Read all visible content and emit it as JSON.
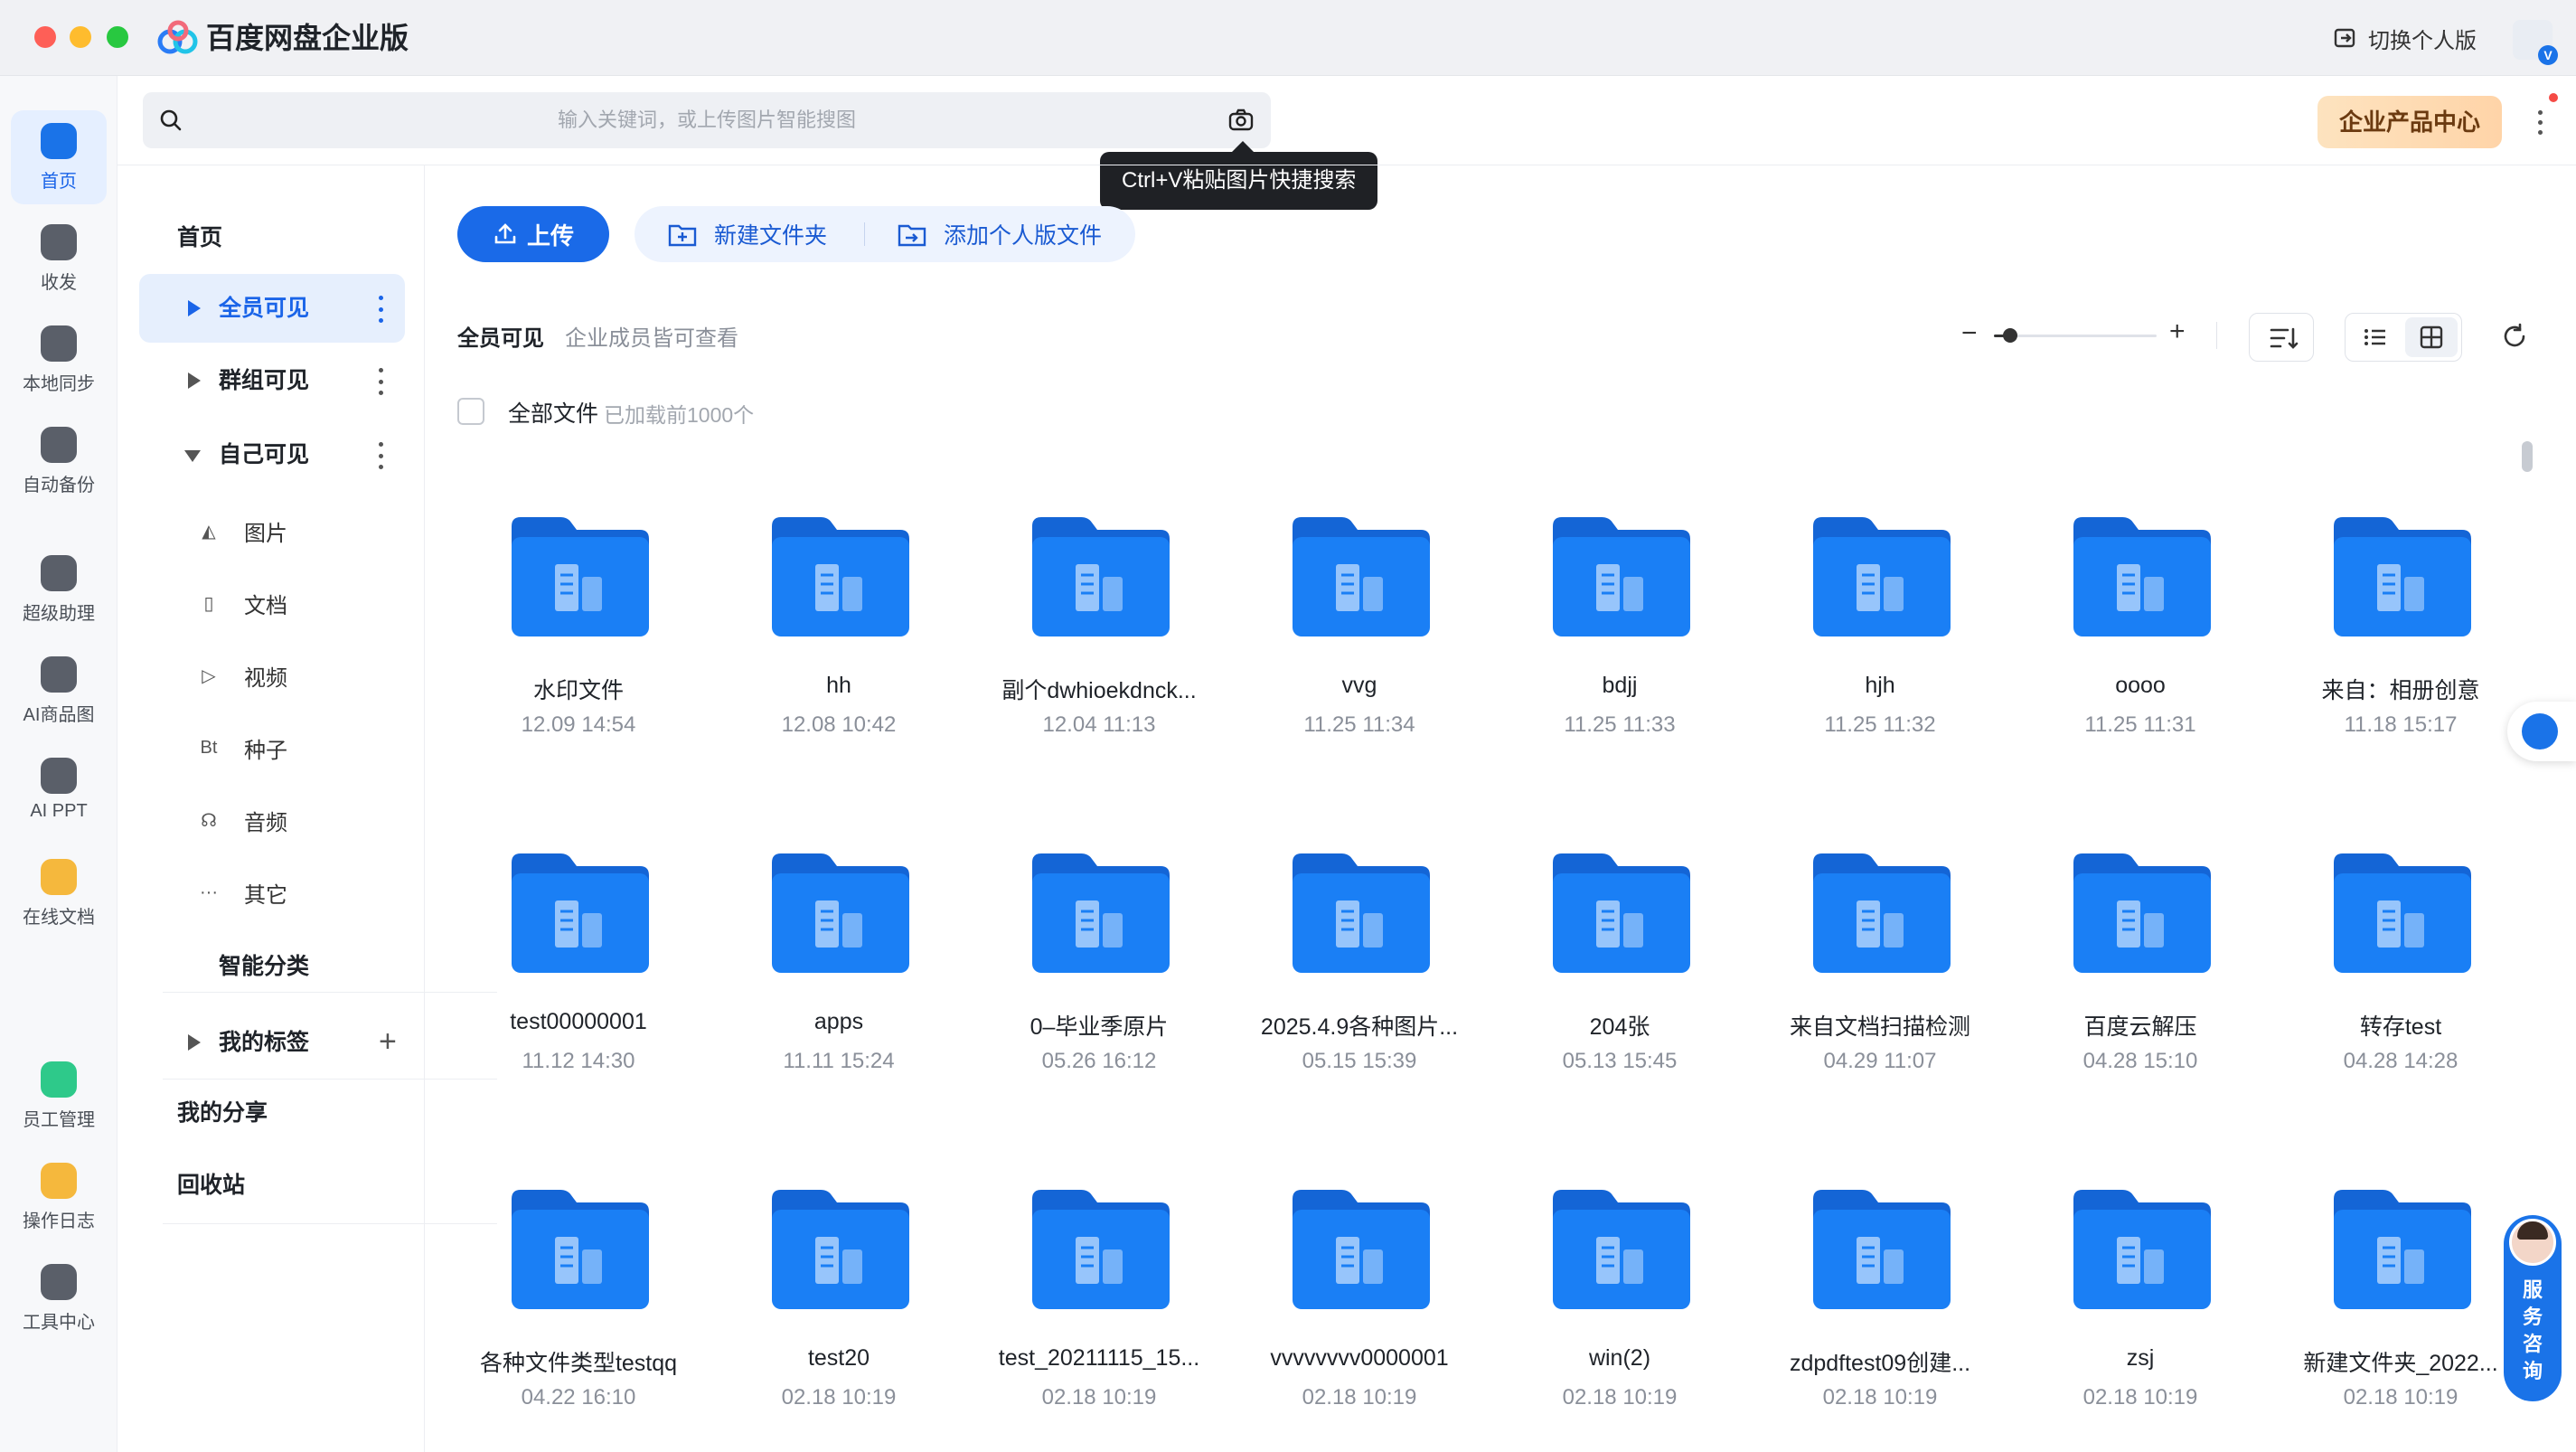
{
  "app": {
    "title": "百度网盘企业版",
    "switch_label": "切换个人版",
    "avatar_badge": "V"
  },
  "rail": [
    {
      "label": "首页",
      "icon": "home-icon",
      "color": "#1a73e8",
      "active": true
    },
    {
      "label": "收发",
      "icon": "transfer-icon",
      "color": "#5a5f69"
    },
    {
      "label": "本地同步",
      "icon": "sync-icon",
      "color": "#5a5f69"
    },
    {
      "label": "自动备份",
      "icon": "backup-icon",
      "color": "#5a5f69"
    },
    {
      "label": "超级助理",
      "icon": "ai-assistant-icon",
      "color": "#5a5f69"
    },
    {
      "label": "AI商品图",
      "icon": "ai-product-icon",
      "color": "#5a5f69"
    },
    {
      "label": "AI PPT",
      "icon": "ai-ppt-icon",
      "color": "#5a5f69"
    },
    {
      "label": "在线文档",
      "icon": "online-doc-icon",
      "color": "#f5b83d"
    },
    {
      "label": "员工管理",
      "icon": "staff-icon",
      "color": "#2ec98a"
    },
    {
      "label": "操作日志",
      "icon": "log-icon",
      "color": "#f5b83d"
    },
    {
      "label": "工具中心",
      "icon": "tools-icon",
      "color": "#5a5f69"
    }
  ],
  "search": {
    "placeholder": "输入关键词，或上传图片智能搜图",
    "tooltip": "Ctrl+V粘贴图片快捷搜索"
  },
  "product_center": "企业产品中心",
  "nav": {
    "home": "首页",
    "all_visible": "全员可见",
    "group_visible": "群组可见",
    "self_visible": "自己可见",
    "sub": [
      {
        "label": "图片",
        "icon": "image-icon",
        "glyph": "◭"
      },
      {
        "label": "文档",
        "icon": "document-icon",
        "glyph": "▯"
      },
      {
        "label": "视频",
        "icon": "video-icon",
        "glyph": "▷"
      },
      {
        "label": "种子",
        "icon": "torrent-icon",
        "glyph": "Bt"
      },
      {
        "label": "音频",
        "icon": "audio-icon",
        "glyph": "☊"
      },
      {
        "label": "其它",
        "icon": "other-icon",
        "glyph": "···"
      }
    ],
    "smart_category": "智能分类",
    "my_tags": "我的标签",
    "my_share": "我的分享",
    "recycle": "回收站"
  },
  "toolbar": {
    "upload": "上传",
    "new_folder": "新建文件夹",
    "add_personal": "添加个人版文件"
  },
  "scope": {
    "title": "全员可见",
    "desc": "企业成员皆可查看",
    "zoom_minus": "−",
    "zoom_plus": "+",
    "zoom_level": 0.1
  },
  "list": {
    "all_files": "全部文件",
    "loaded": "已加载前1000个"
  },
  "folders": [
    {
      "name": "水印文件",
      "date": "12.09 14:54"
    },
    {
      "name": "hh",
      "date": "12.08 10:42"
    },
    {
      "name": "副个dwhioekdnck...",
      "date": "12.04 11:13"
    },
    {
      "name": "vvg",
      "date": "11.25 11:34"
    },
    {
      "name": "bdjj",
      "date": "11.25 11:33"
    },
    {
      "name": "hjh",
      "date": "11.25 11:32"
    },
    {
      "name": "oooo",
      "date": "11.25 11:31"
    },
    {
      "name": "来自：相册创意",
      "date": "11.18 15:17"
    },
    {
      "name": "test00000001",
      "date": "11.12 14:30"
    },
    {
      "name": "apps",
      "date": "11.11 15:24"
    },
    {
      "name": "0–毕业季原片",
      "date": "05.26 16:12"
    },
    {
      "name": "2025.4.9各种图片...",
      "date": "05.15 15:39"
    },
    {
      "name": "204张",
      "date": "05.13 15:45"
    },
    {
      "name": "来自文档扫描检测",
      "date": "04.29 11:07"
    },
    {
      "name": "百度云解压",
      "date": "04.28 15:10"
    },
    {
      "name": "转存test",
      "date": "04.28 14:28"
    },
    {
      "name": "各种文件类型testqq",
      "date": "04.22 16:10"
    },
    {
      "name": "test20",
      "date": "02.18 10:19"
    },
    {
      "name": "test_20211115_15...",
      "date": "02.18 10:19"
    },
    {
      "name": "vvvvvvvv0000001",
      "date": "02.18 10:19"
    },
    {
      "name": "win(2)",
      "date": "02.18 10:19"
    },
    {
      "name": "zdpdftest09创建...",
      "date": "02.18 10:19"
    },
    {
      "name": "zsj",
      "date": "02.18 10:19"
    },
    {
      "name": "新建文件夹_2022...",
      "date": "02.18 10:19"
    }
  ],
  "service": "服务咨询",
  "colors": {
    "accent": "#1a6ae8",
    "folder": "#1a7ff5",
    "folder_back": "#1465d6"
  }
}
